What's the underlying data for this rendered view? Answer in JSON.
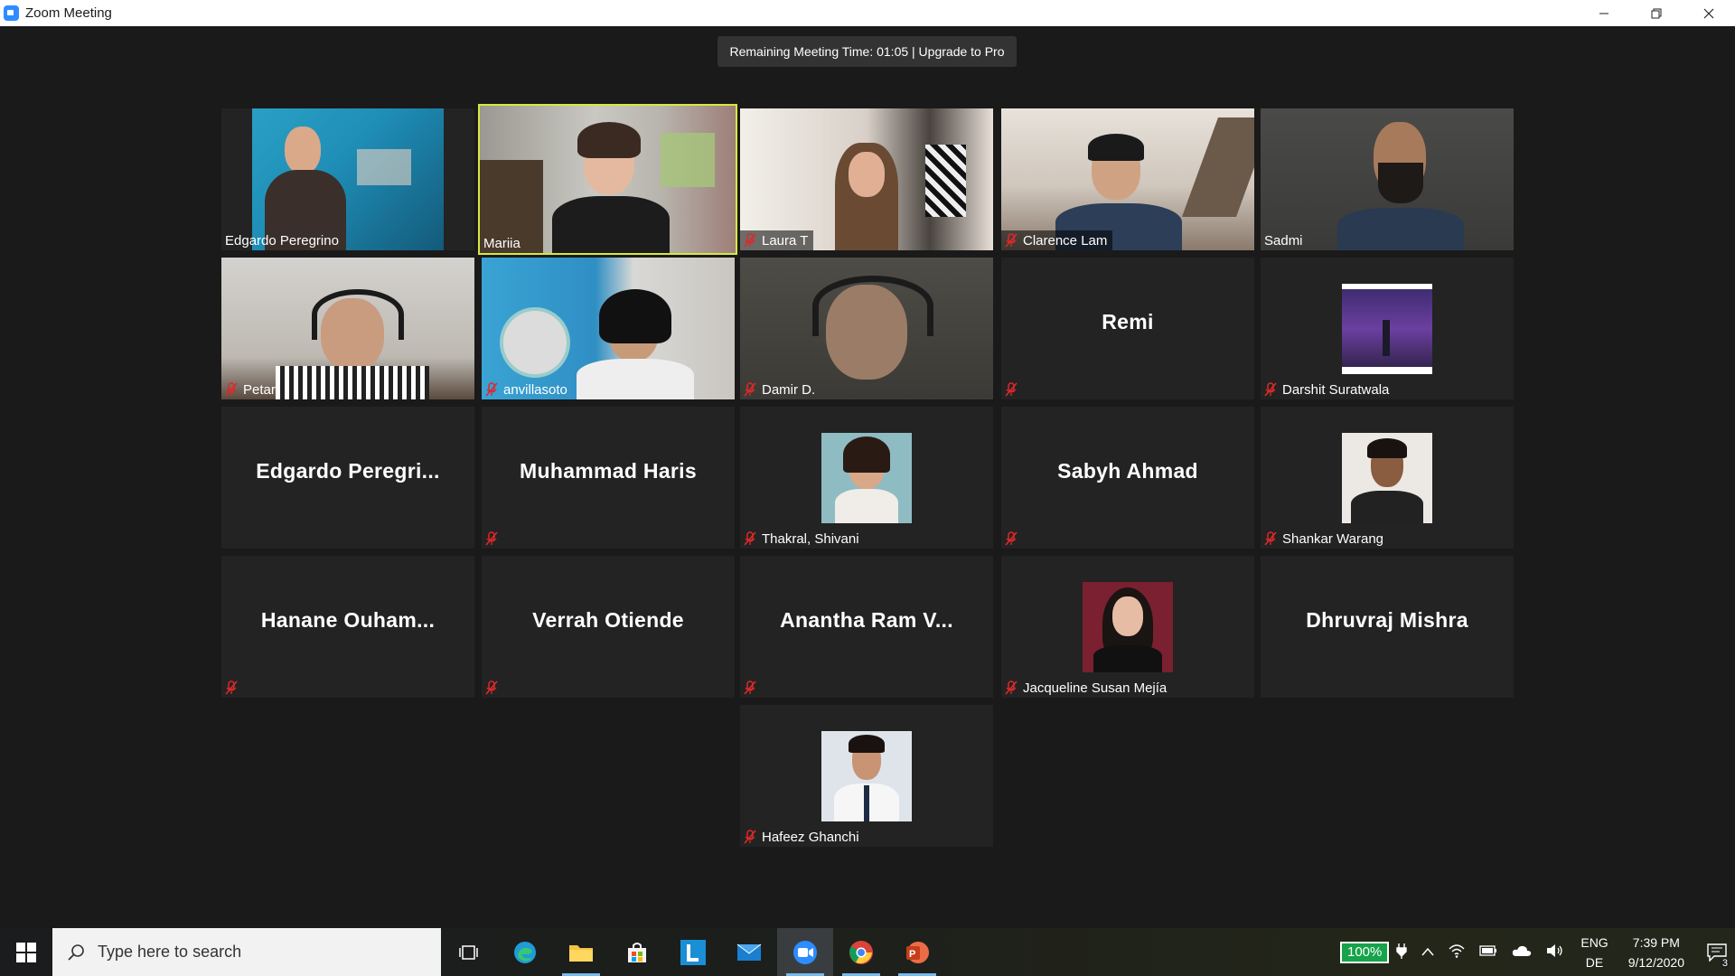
{
  "window": {
    "title": "Zoom Meeting"
  },
  "meeting": {
    "remaining": "Remaining Meeting Time: 01:05 | Upgrade to Pro"
  },
  "tiles": {
    "edgardo_video": "Edgardo Peregrino",
    "mariia": "Mariia",
    "laura": "Laura T",
    "clarence": "Clarence Lam",
    "sadmi": "Sadmi",
    "petar": "Petar",
    "anvillasoto": "anvillasoto",
    "damir": "Damir D.",
    "remi": "Remi",
    "darshit": "Darshit Suratwala",
    "edgardo_big": "Edgardo  Peregri...",
    "muhammad": "Muhammad Haris",
    "shivani": "Thakral, Shivani",
    "sabyh": "Sabyh Ahmad",
    "shankar": "Shankar Warang",
    "hanane": "Hanane  Ouham...",
    "verrah": "Verrah Otiende",
    "anantha": "Anantha Ram V...",
    "jacqueline": "Jacqueline Susan Mejía",
    "dhruvraj": "Dhruvraj Mishra",
    "hafeez": "Hafeez Ghanchi"
  },
  "taskbar": {
    "search_placeholder": "Type here to search",
    "battery": "100%",
    "lang_top": "ENG",
    "lang_bottom": "DE",
    "time": "7:39 PM",
    "date": "9/12/2020",
    "notif_count": "3"
  },
  "colors": {
    "active_speaker": "#d7e83f",
    "muted": "#e02828",
    "zoom_blue": "#2d8cff"
  }
}
